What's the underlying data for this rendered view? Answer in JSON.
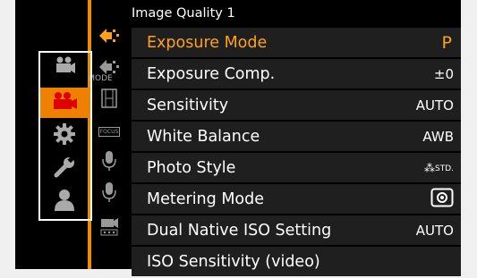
{
  "page_title": "Image Quality 1",
  "menu_rows": [
    {
      "label": "Exposure Mode",
      "value": "P",
      "active": true
    },
    {
      "label": "Exposure Comp.",
      "value": "±0",
      "active": false
    },
    {
      "label": "Sensitivity",
      "value": "AUTO",
      "active": false
    },
    {
      "label": "White Balance",
      "value": "AWB",
      "active": false
    },
    {
      "label": "Photo Style",
      "value": "STD.",
      "active": false
    },
    {
      "label": "Metering Mode",
      "value": "",
      "active": false
    },
    {
      "label": "Dual Native ISO Setting",
      "value": "AUTO",
      "active": false
    },
    {
      "label": "ISO Sensitivity (video)",
      "value": "",
      "active": false
    }
  ],
  "left_categories": [
    {
      "icon": "movie-mode-icon",
      "label": "MODE",
      "selected": false
    },
    {
      "icon": "video-camera-icon",
      "label": "",
      "selected": true
    },
    {
      "icon": "gear-icon",
      "label": "",
      "selected": false
    },
    {
      "icon": "wrench-icon",
      "label": "",
      "selected": false
    },
    {
      "icon": "person-icon",
      "label": "",
      "selected": false
    }
  ],
  "mid_tabs": [
    {
      "icon": "image-quality-tab-icon",
      "label": "",
      "active": true
    },
    {
      "icon": "image-quality-tab-icon-2",
      "label": "",
      "active": false
    },
    {
      "icon": "film-icon",
      "label": "",
      "active": false
    },
    {
      "icon": "focus-icon",
      "label": "FOCUS",
      "active": false
    },
    {
      "icon": "microphone-icon",
      "label": "",
      "active": false
    },
    {
      "icon": "microphone-icon-2",
      "label": "",
      "active": false
    },
    {
      "icon": "camera-rig-icon",
      "label": "",
      "active": false
    }
  ],
  "colors": {
    "accent": "#f08a00",
    "row_bg": "#1f1f1f",
    "active_text": "#ffa21a"
  }
}
